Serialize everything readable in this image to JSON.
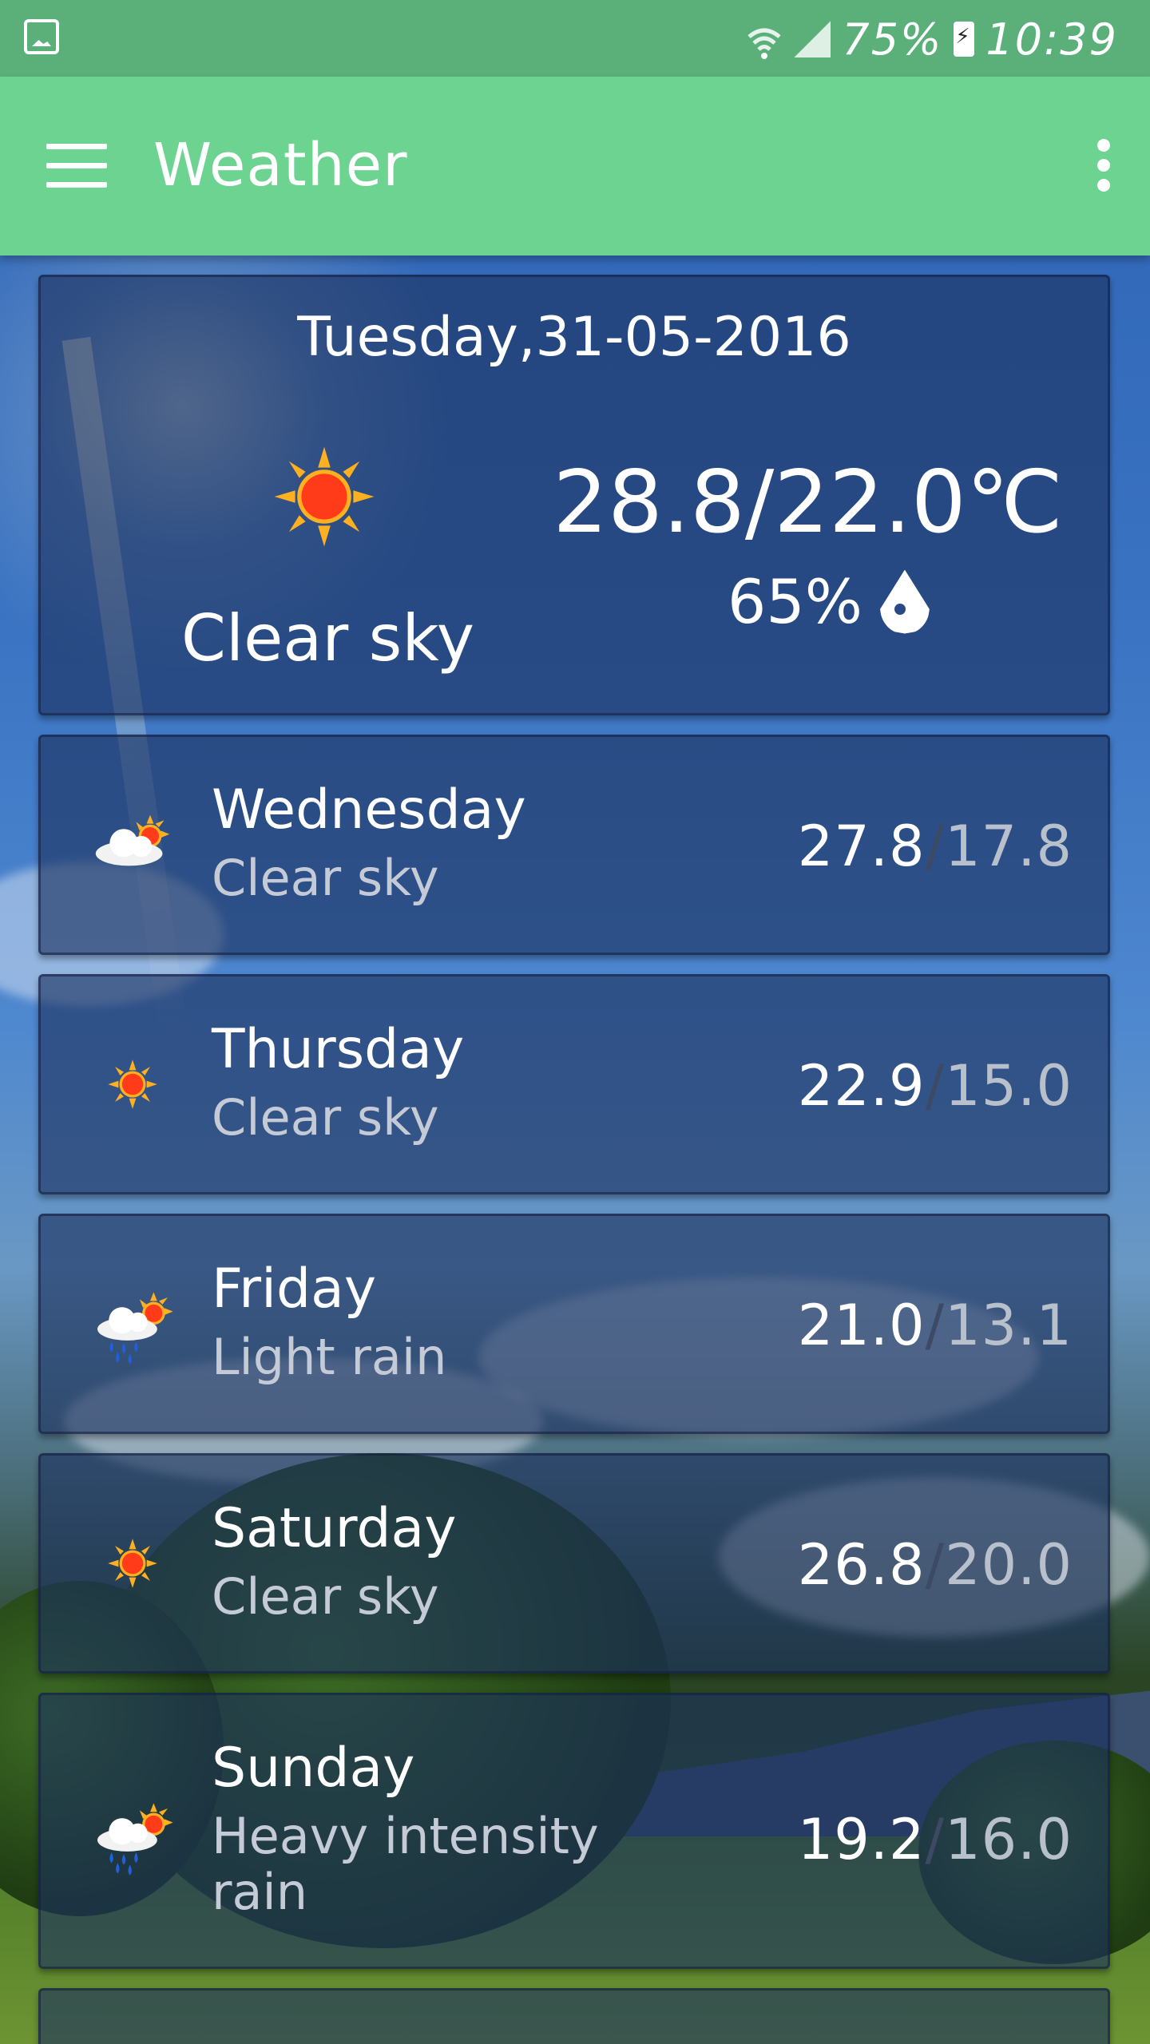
{
  "status_bar": {
    "battery": "75%",
    "time": "10:39"
  },
  "app_bar": {
    "title": "Weather"
  },
  "today": {
    "date": "Tuesday,31-05-2016",
    "temperature": "28.8/22.0℃",
    "humidity": "65%",
    "description": "Clear sky",
    "icon": "sun-icon"
  },
  "forecast": [
    {
      "day": "Wednesday",
      "description": "Clear sky",
      "max": "27.8",
      "min": "17.8",
      "icon": "cloud-sun-icon"
    },
    {
      "day": "Thursday",
      "description": "Clear sky",
      "max": "22.9",
      "min": "15.0",
      "icon": "sun-icon"
    },
    {
      "day": "Friday",
      "description": "Light rain",
      "max": "21.0",
      "min": "13.1",
      "icon": "rain-sun-icon"
    },
    {
      "day": "Saturday",
      "description": "Clear sky",
      "max": "26.8",
      "min": "20.0",
      "icon": "sun-icon"
    },
    {
      "day": "Sunday",
      "description": "Heavy intensity rain",
      "max": "19.2",
      "min": "16.0",
      "icon": "rain-sun-icon"
    }
  ],
  "temp_separator": "/",
  "colors": {
    "status_bar": "#5bb07a",
    "app_bar": "#6dd391",
    "card": "#1c305e",
    "sun": "#ff3b1a"
  }
}
